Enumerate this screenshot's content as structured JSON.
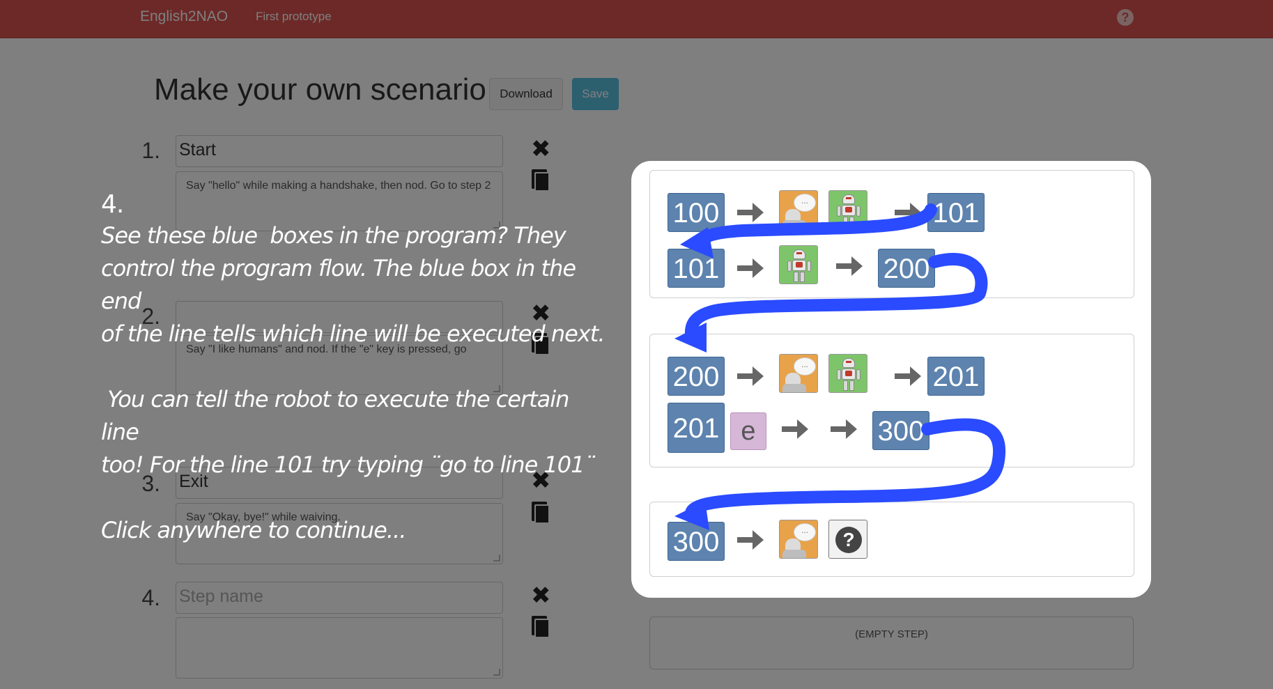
{
  "navbar": {
    "brand": "English2NAO",
    "link": "First prototype",
    "help": "?"
  },
  "header": {
    "title": "Make your own scenario",
    "download_label": "Download",
    "save_label": "Save"
  },
  "steps": [
    {
      "number": "1.",
      "name": "Start",
      "description": "Say \"hello\" while making a handshake, then nod. Go to step 2"
    },
    {
      "number": "2.",
      "name": "",
      "description": "Say \"I like humans\" and nod. If the \"e\" key is pressed, go"
    },
    {
      "number": "3.",
      "name": "Exit",
      "description": "Say \"Okay, bye!\" while waiving."
    },
    {
      "number": "4.",
      "name": "",
      "name_placeholder": "Step name",
      "description": ""
    }
  ],
  "empty_step": "(EMPTY STEP)",
  "tutorial": {
    "step": "4.",
    "paragraph1": "See these blue  boxes in the program? They\ncontrol the program flow. The blue box in the end\nof the line tells which line will be executed next.",
    "paragraph2": " You can tell the robot to execute the certain line\ntoo! For the line 101 try typing ¨go to line 101¨",
    "paragraph3": "Click anywhere to continue..."
  },
  "program": {
    "groups": [
      {
        "rows": [
          {
            "start": "100",
            "actions": [
              "say-icon",
              "move-icon"
            ],
            "next": "101"
          },
          {
            "start": "101",
            "actions": [
              "move-icon"
            ],
            "next": "200"
          }
        ]
      },
      {
        "rows": [
          {
            "start": "200",
            "actions": [
              "say-icon",
              "move-icon"
            ],
            "next": "201"
          },
          {
            "start": "201",
            "key": "e",
            "actions": [],
            "next": "300"
          }
        ]
      },
      {
        "rows": [
          {
            "start": "300",
            "actions": [
              "say-icon",
              "question-icon"
            ],
            "next": ""
          }
        ]
      }
    ],
    "bubble_text": "...",
    "question_mark": "?",
    "colors": {
      "flow_box": "#5d83ae",
      "flow_arrow": "#2a4bff",
      "say_tile": "#e8a24a",
      "move_tile": "#7ec46a",
      "navbar": "#d9534f"
    }
  }
}
